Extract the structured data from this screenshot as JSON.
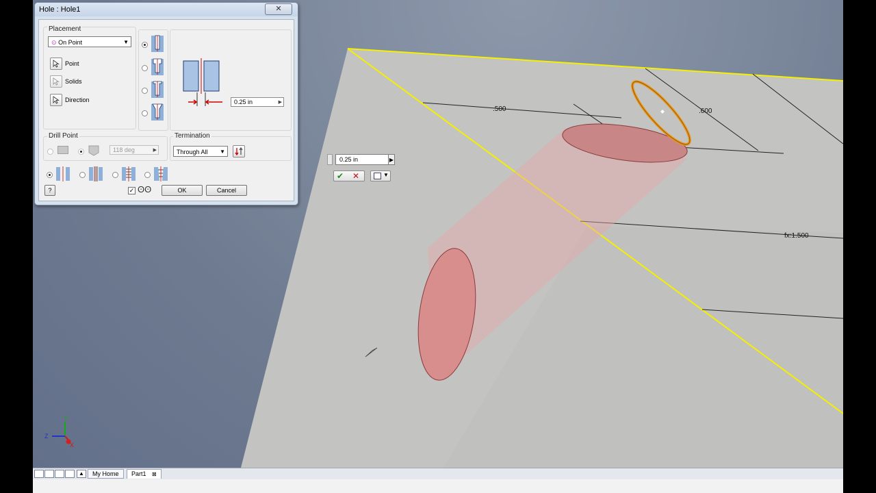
{
  "dialog": {
    "title": "Hole : Hole1",
    "close_label": "✕",
    "placement": {
      "group_label": "Placement",
      "selected": "On Point",
      "point_label": "Point",
      "solids_label": "Solids",
      "direction_label": "Direction"
    },
    "diameter_value": "0.25 in",
    "drill_point": {
      "group_label": "Drill Point",
      "angle_value": "118 deg"
    },
    "termination": {
      "group_label": "Termination",
      "selected": "Through All"
    },
    "ok_label": "OK",
    "cancel_label": "Cancel",
    "help_label": "?"
  },
  "minitoolbar": {
    "value": "0.25 in"
  },
  "dimensions": {
    "dim_500": ".500",
    "dim_600": ".600",
    "dim_1500": "fx:1.500"
  },
  "tabs": {
    "home_label": "My Home",
    "part_label": "Part1",
    "part_close": "⊠"
  },
  "axes": {
    "x": "X",
    "y": "Y",
    "z": "Z"
  },
  "colors": {
    "edge_yellow": "#f5f000",
    "plate": "#c2c2c2",
    "hole_red": "#e9a3a3",
    "ring_orange": "#e8981a"
  }
}
